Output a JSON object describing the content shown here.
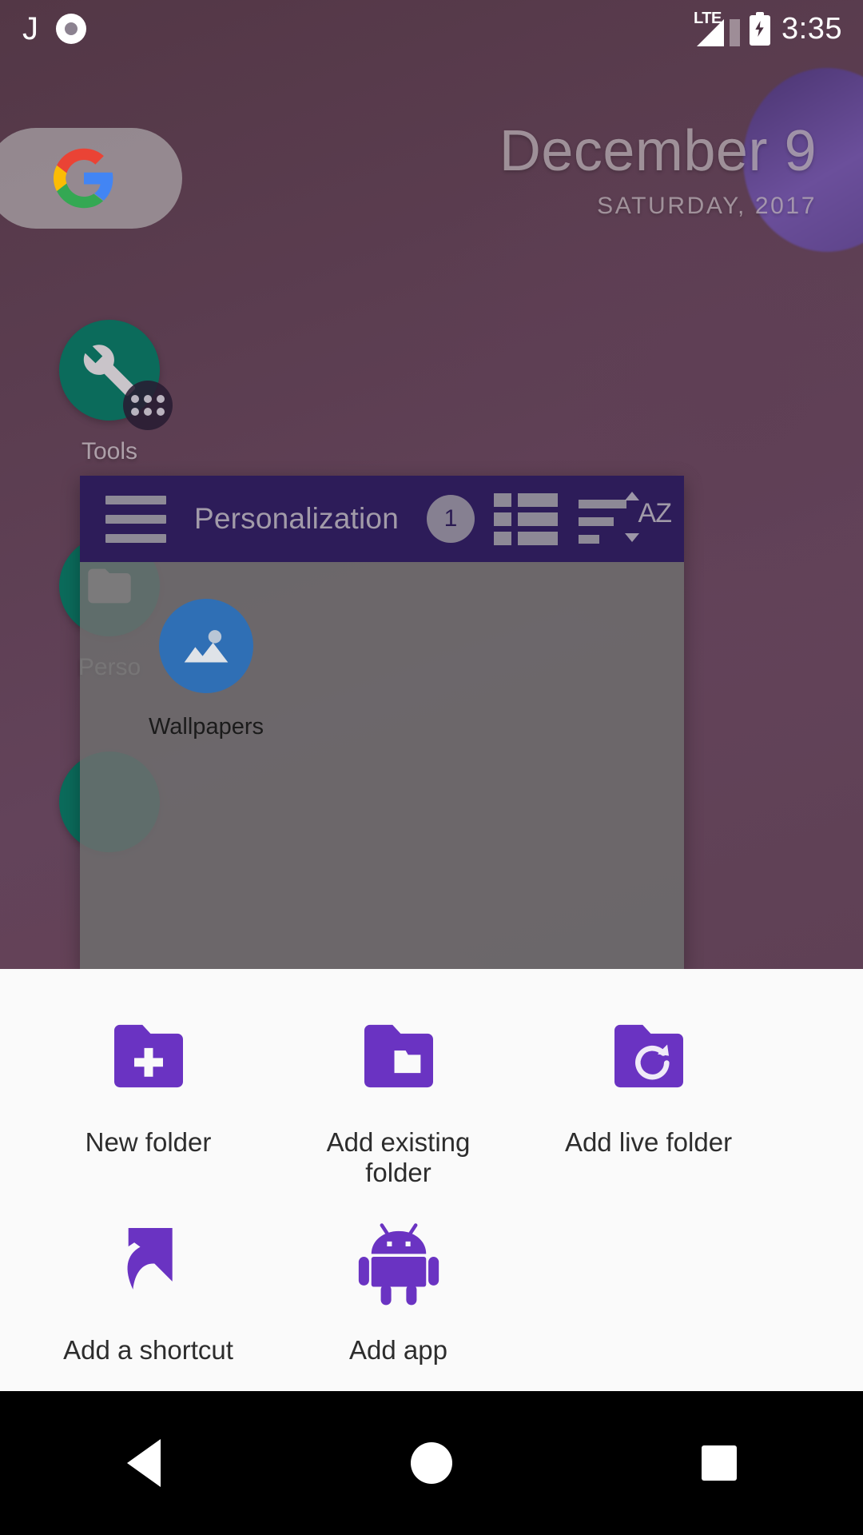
{
  "status_bar": {
    "left_letter": "J",
    "record_icon": "circle-record-icon",
    "network": "LTE",
    "battery_icon": "battery-charging-icon",
    "time": "3:35"
  },
  "home_screen": {
    "search_widget": {
      "icon": "google-g-icon"
    },
    "date_widget": {
      "date": "December 9",
      "day_year": "SATURDAY, 2017"
    },
    "icons": [
      {
        "label": "Tools",
        "icon": "wrench-icon",
        "color": "#0b6b5b",
        "badge": "folder-dots-badge"
      },
      {
        "label": "Perso",
        "icon": "folder-icon",
        "color": "#0b6b5b"
      }
    ]
  },
  "drawer": {
    "toolbar": {
      "menu_icon": "hamburger-menu-icon",
      "title": "Personalization",
      "badge_count": "1",
      "list_view_icon": "list-view-icon",
      "sort_icon": "sort-az-icon",
      "sort_label": "AZ",
      "background_color": "#2d1c59"
    },
    "apps": [
      {
        "label": "Wallpapers",
        "icon": "wallpaper-image-icon",
        "color": "#2f6fb5"
      }
    ]
  },
  "bottom_sheet": {
    "items": [
      {
        "label": "New folder",
        "icon": "folder-plus-icon"
      },
      {
        "label": "Add existing folder",
        "icon": "folder-nested-icon"
      },
      {
        "label": "Add live folder",
        "icon": "folder-refresh-icon"
      },
      {
        "label": "Add a shortcut",
        "icon": "shortcut-arrow-icon"
      },
      {
        "label": "Add app",
        "icon": "android-robot-icon"
      }
    ],
    "accent_color": "#6a33c2",
    "background_color": "#fafafa"
  },
  "nav_bar": {
    "back": "back-triangle-icon",
    "home": "home-circle-icon",
    "recents": "recents-square-icon"
  }
}
